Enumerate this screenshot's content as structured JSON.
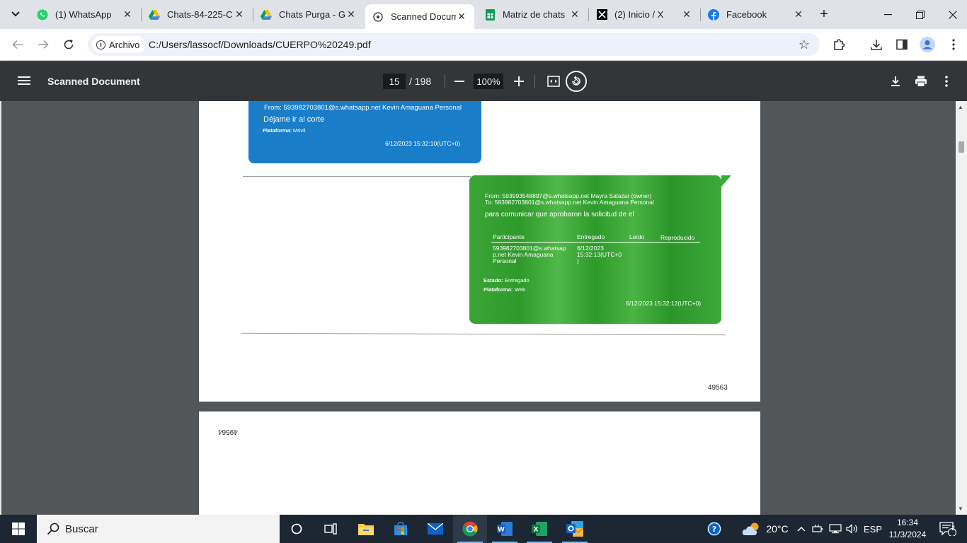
{
  "tabs": [
    {
      "title": "(1) WhatsApp",
      "icon": "whatsapp-icon",
      "active": false
    },
    {
      "title": "Chats-84-225-C",
      "icon": "drive-icon",
      "active": false
    },
    {
      "title": "Chats Purga - G",
      "icon": "drive-icon",
      "active": false
    },
    {
      "title": "Scanned Docum",
      "icon": "globe-icon",
      "active": true
    },
    {
      "title": "Matriz de chats",
      "icon": "sheets-icon",
      "active": false
    },
    {
      "title": "(2) Inicio / X",
      "icon": "x-icon",
      "active": false
    },
    {
      "title": "Facebook",
      "icon": "facebook-icon",
      "active": false
    }
  ],
  "address": {
    "chip_label": "Archivo",
    "url": "C:/Users/lassocf/Downloads/CUERPO%20249.pdf"
  },
  "pdf": {
    "title": "Scanned Document",
    "current_page": "15",
    "total_pages": "/ 198",
    "zoom": "100%"
  },
  "blue_message": {
    "from": "From: 593982703801@s.whatsapp.net Kevin Amaguana Personal",
    "body": "Déjame ir al corte",
    "platform_label": "Plataforma:",
    "platform": "Móvil",
    "timestamp": "6/12/2023 15:32:10(UTC+0)"
  },
  "green_message": {
    "from": "From: 593993548897@s.whatsapp.net Mayra Salazar (owner)",
    "to": "To: 593982703801@s.whatsapp.net Kevin Amaguana Personal",
    "body": "para comunicar que aprobaron la solicitud de el",
    "table_headers": [
      "Participante",
      "Entregado",
      "Leído",
      "Reproducido"
    ],
    "participant_lines": [
      "593982703801@s.whatsap",
      "p.net Kevin Amaguana",
      "Personal"
    ],
    "delivered_lines": [
      "6/12/2023",
      "15:32:13(UTC+0",
      ")"
    ],
    "status_label": "Estado:",
    "status": "Entregado",
    "platform_label": "Plataforma:",
    "platform": "Web",
    "timestamp": "6/12/2023 15:32:12(UTC+0)"
  },
  "page_number": "49563",
  "next_page_number": "49564",
  "taskbar": {
    "search_placeholder": "Buscar",
    "temperature": "20°C",
    "language": "ESP",
    "time": "16:34",
    "date": "11/3/2024",
    "notifications": "2"
  }
}
